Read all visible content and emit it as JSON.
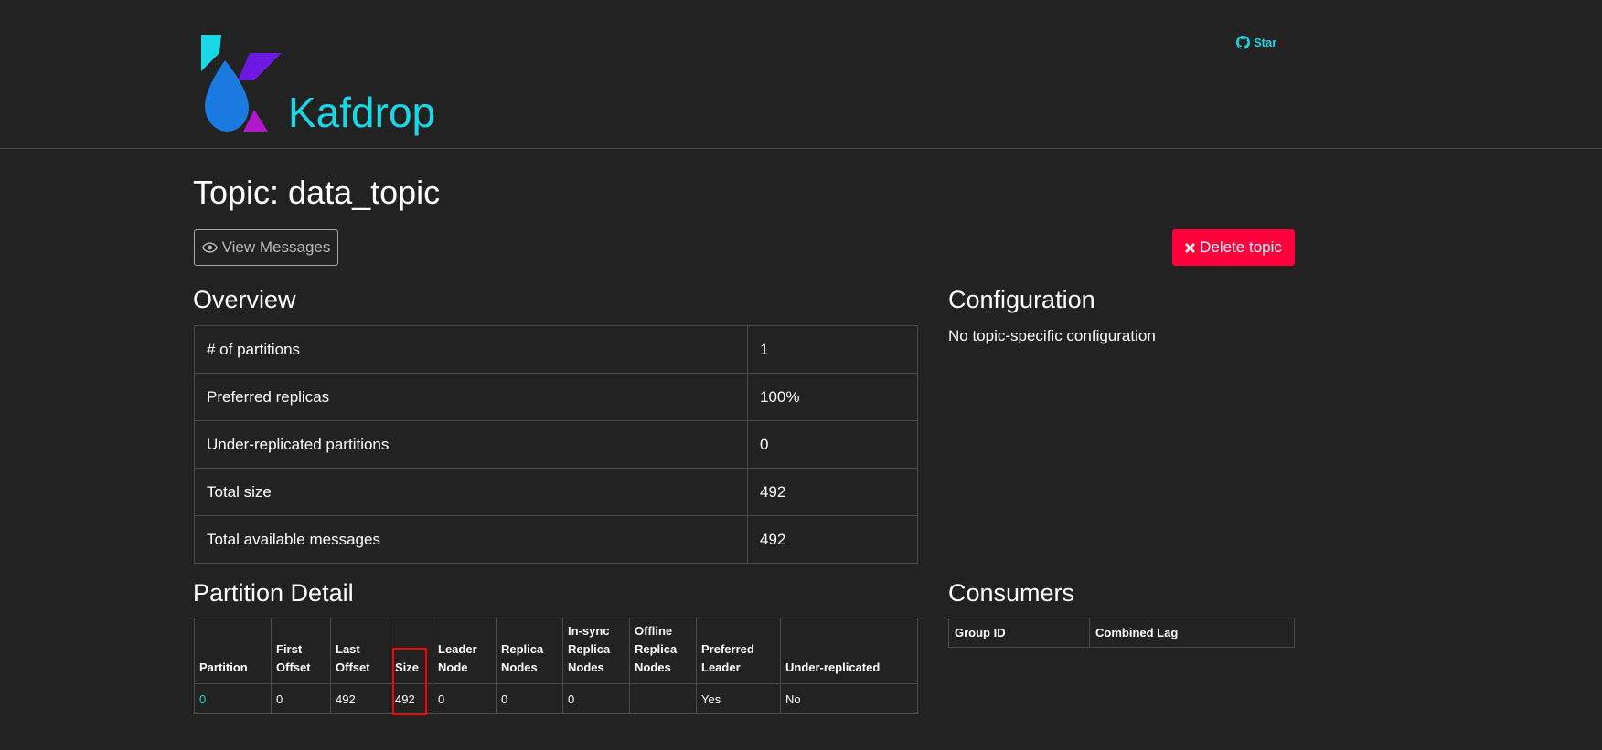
{
  "header": {
    "brand": "Kafdrop",
    "star_label": "Star",
    "icons": {
      "star": "github-icon"
    }
  },
  "page": {
    "title": "Topic: data_topic"
  },
  "toolbar": {
    "view_messages_label": "View Messages",
    "delete_topic_label": "Delete topic",
    "icons": {
      "view": "eye-icon",
      "delete": "close-icon"
    }
  },
  "overview": {
    "title": "Overview",
    "rows": [
      {
        "label": "# of partitions",
        "value": "1"
      },
      {
        "label": "Preferred replicas",
        "value": "100%"
      },
      {
        "label": "Under-replicated partitions",
        "value": "0"
      },
      {
        "label": "Total size",
        "value": "492"
      },
      {
        "label": "Total available messages",
        "value": "492"
      }
    ]
  },
  "configuration": {
    "title": "Configuration",
    "text": "No topic-specific configuration"
  },
  "partition_detail": {
    "title": "Partition Detail",
    "headers": [
      [
        "Partition"
      ],
      [
        "First",
        "Offset"
      ],
      [
        "Last",
        "Offset"
      ],
      [
        "Size"
      ],
      [
        "Leader",
        "Node"
      ],
      [
        "Replica",
        "Nodes"
      ],
      [
        "In-sync",
        "Replica",
        "Nodes"
      ],
      [
        "Offline",
        "Replica",
        "Nodes"
      ],
      [
        "Preferred",
        "Leader"
      ],
      [
        "Under-replicated"
      ]
    ],
    "rows": [
      [
        "0",
        "0",
        "492",
        "492",
        "0",
        "0",
        "0",
        "",
        "Yes",
        "No"
      ]
    ]
  },
  "consumers": {
    "title": "Consumers",
    "headers": [
      "Group ID",
      "Combined Lag"
    ]
  },
  "colors": {
    "background": "#222222",
    "accent": "#1ad7e5",
    "danger": "#ff003c",
    "highlight": "#ff0000"
  }
}
